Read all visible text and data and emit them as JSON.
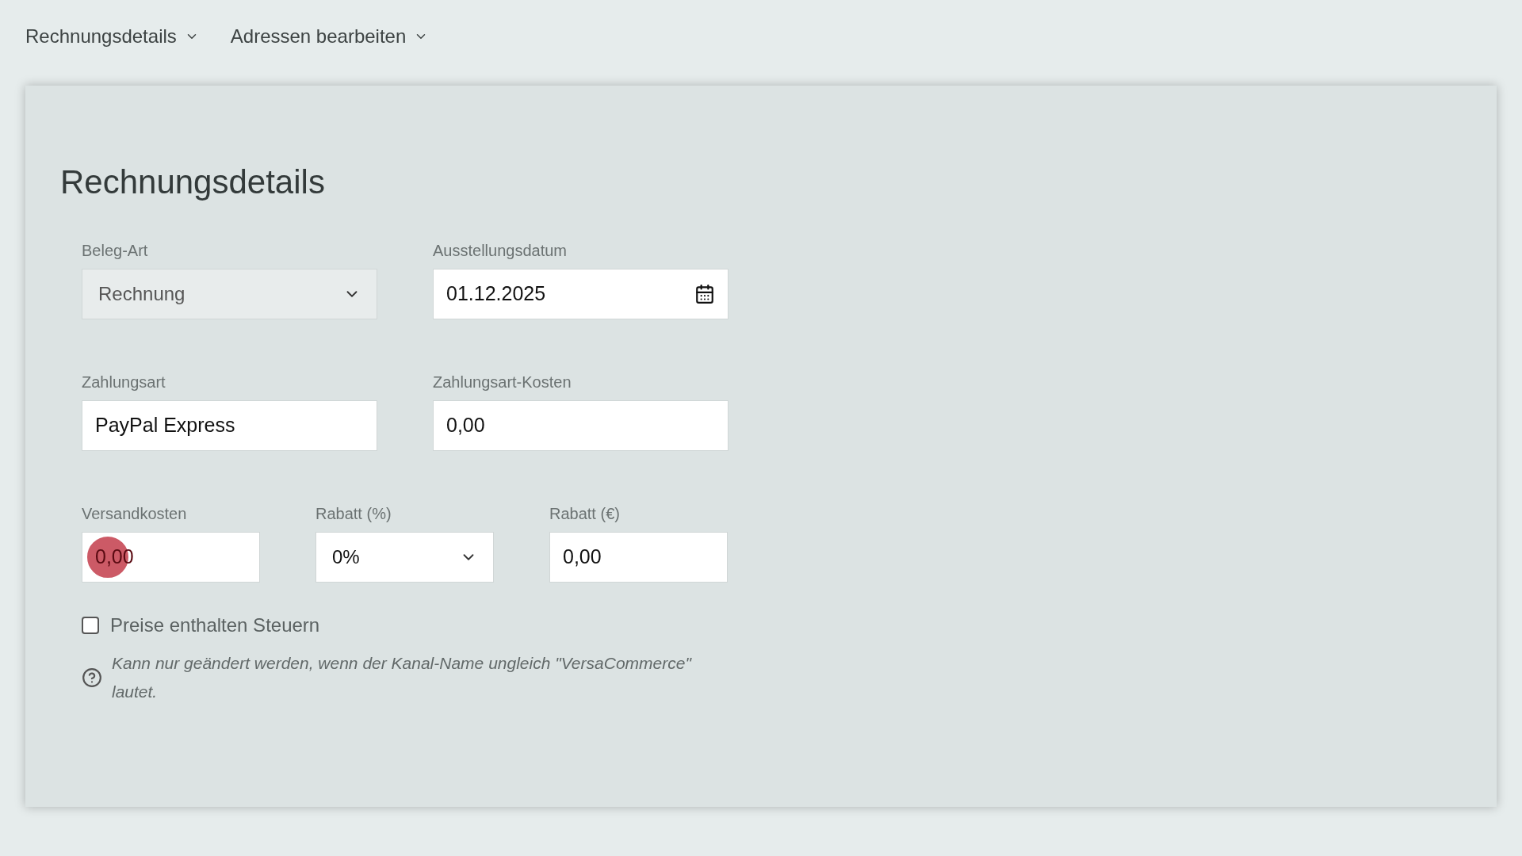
{
  "nav": [
    {
      "label": "Rechnungsdetails"
    },
    {
      "label": "Adressen bearbeiten"
    }
  ],
  "card": {
    "title": "Rechnungsdetails",
    "rows": [
      [
        {
          "label": "Beleg-Art",
          "kind": "select",
          "value": "Rechnung",
          "disabled": true
        },
        {
          "label": "Ausstellungsdatum",
          "kind": "date",
          "value": "01.12.2025"
        }
      ],
      [
        {
          "label": "Zahlungsart",
          "kind": "text",
          "value": "PayPal Express"
        },
        {
          "label": "Zahlungsart-Kosten",
          "kind": "text",
          "value": "0,00"
        }
      ],
      [
        {
          "label": "Versandkosten",
          "kind": "text",
          "value": "0,00",
          "clicked": true
        },
        {
          "label": "Rabatt (%)",
          "kind": "select",
          "value": "0%"
        },
        {
          "label": "Rabatt (€)",
          "kind": "text",
          "value": "0,00"
        }
      ]
    ],
    "checkbox": {
      "label": "Preise enthalten Steuern",
      "checked": false
    },
    "help": "Kann nur geändert werden, wenn der Kanal-Name ungleich \"VersaCommerce\" lautet."
  }
}
